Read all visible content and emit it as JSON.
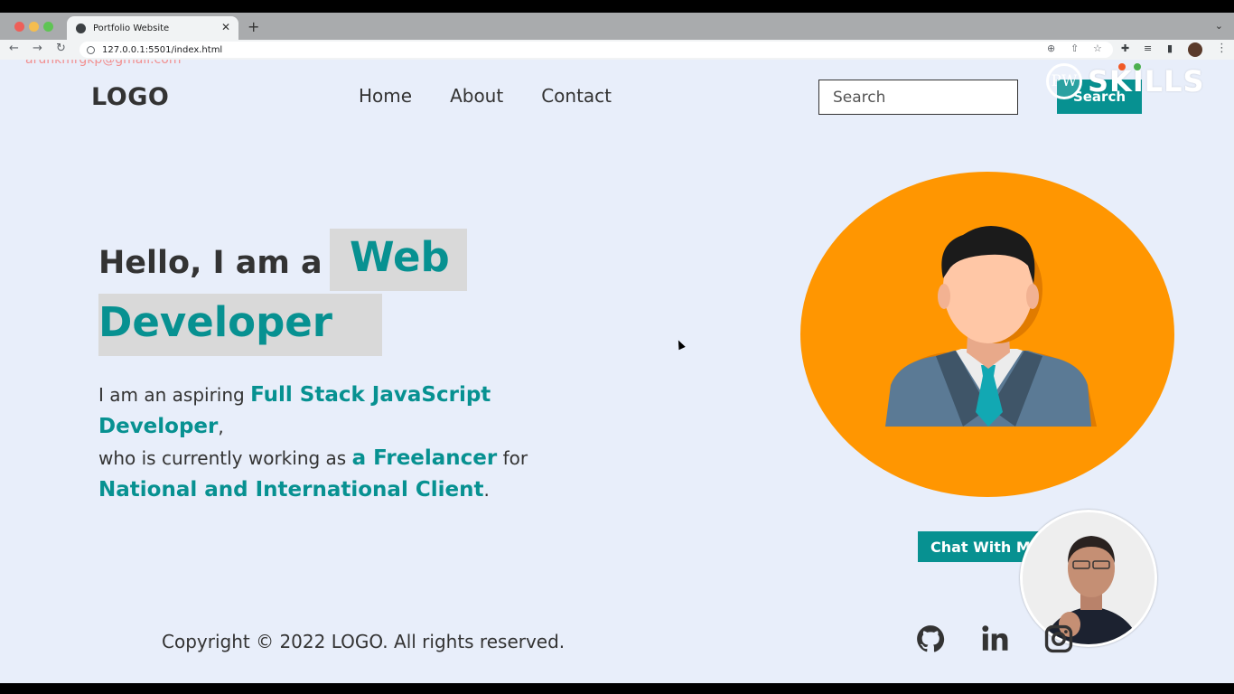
{
  "browser": {
    "tab_title": "Portfolio Website",
    "tab_close": "✕",
    "new_tab": "+",
    "url": "127.0.0.1:5501/index.html"
  },
  "overlay": {
    "email": "arunkmrgkp@gmail.com",
    "brand_pw": "PW",
    "brand_name": "SKILLS"
  },
  "header": {
    "logo": "LOGO",
    "nav": [
      "Home",
      "About",
      "Contact"
    ],
    "search_placeholder": "Search",
    "search_button": "Search"
  },
  "hero": {
    "line1": "Hello, I am a",
    "highlight1": "Web",
    "highlight2": "Developer",
    "para": {
      "t1": "I am an aspiring ",
      "a1": "Full Stack JavaScript Developer",
      "t2": ",",
      "t3": "who is currently working as ",
      "a2": "a Freelancer",
      "t4": " for",
      "a3": "National and International Client",
      "t5": "."
    }
  },
  "chat_button": "Chat With Me",
  "footer": {
    "copyright": "Copyright © 2022 LOGO. All rights reserved.",
    "socials": [
      "github-icon",
      "linkedin-icon",
      "instagram-icon"
    ]
  },
  "colors": {
    "accent": "#079191",
    "avatar_bg": "#ff9601",
    "page_bg": "#e8eefa",
    "highlight_bg": "#d9d9d9"
  }
}
